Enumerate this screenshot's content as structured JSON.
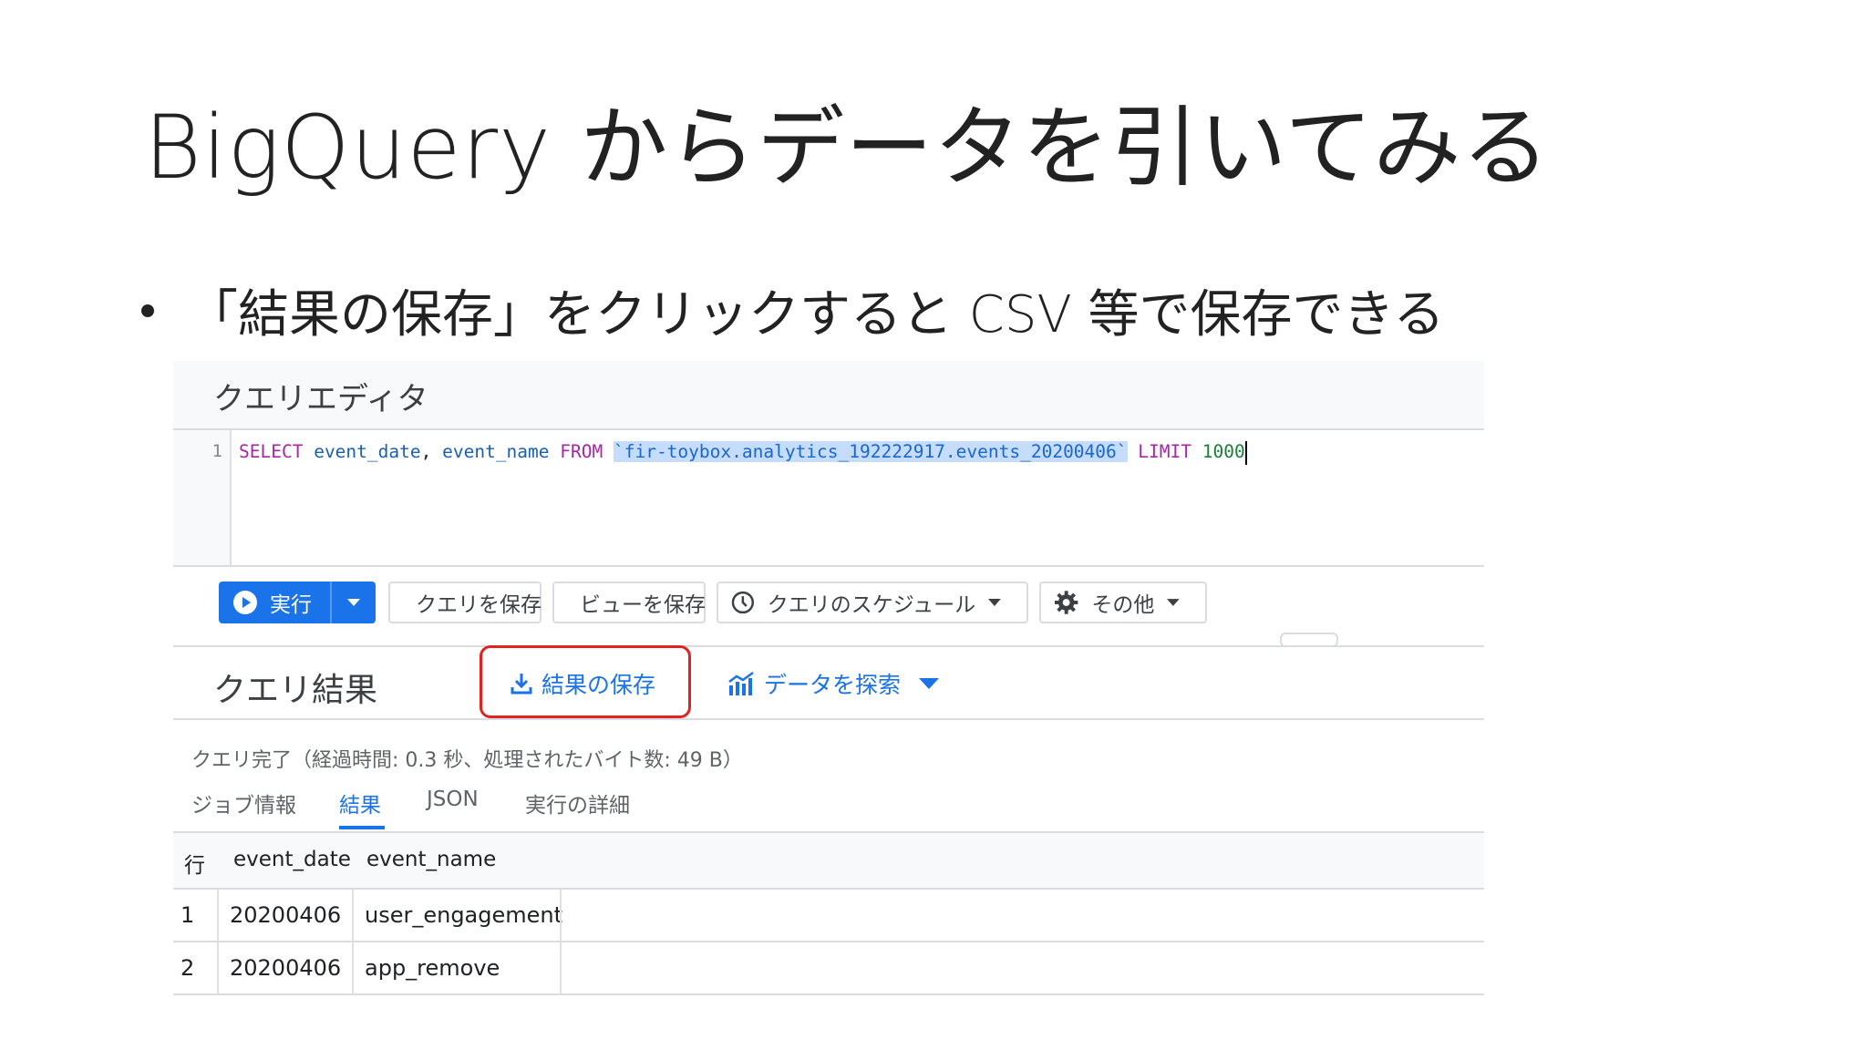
{
  "slide": {
    "title": "BigQuery からデータを引いてみる",
    "bullet": "「結果の保存」をクリックすると CSV 等で保存できる"
  },
  "editor": {
    "title": "クエリエディタ",
    "line_number": "1",
    "sql": {
      "select": "SELECT",
      "col1": "event_date",
      "comma": ",",
      "col2": "event_name",
      "from": "FROM",
      "table": "`fir-toybox.analytics_192222917.events_20200406`",
      "limit": "LIMIT",
      "limit_value": "1000"
    }
  },
  "toolbar": {
    "run_label": "実行",
    "save_query_label": "クエリを保存",
    "save_view_label": "ビューを保存",
    "schedule_label": "クエリのスケジュール",
    "more_label": "その他"
  },
  "results": {
    "title": "クエリ結果",
    "save_results_label": "結果の保存",
    "explore_label": "データを探索",
    "status": "クエリ完了（経過時間: 0.3 秒、処理されたバイト数: 49 B）",
    "tabs": [
      "ジョブ情報",
      "結果",
      "JSON",
      "実行の詳細"
    ],
    "active_tab": "結果",
    "columns": [
      "行",
      "event_date",
      "event_name"
    ],
    "rows": [
      [
        "1",
        "20200406",
        "user_engagement"
      ],
      [
        "2",
        "20200406",
        "app_remove"
      ]
    ]
  },
  "colors": {
    "accent": "#1a73e8",
    "highlight_box": "#e0231f",
    "keyword": "#a626a4",
    "number": "#188038"
  }
}
